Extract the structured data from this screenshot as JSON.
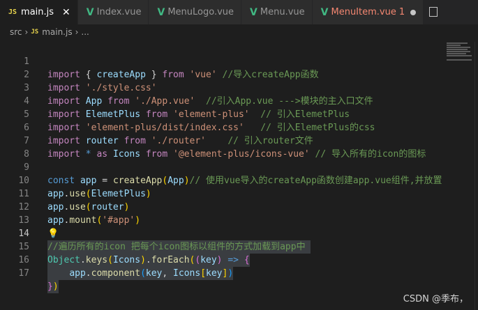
{
  "tabs": [
    {
      "label": "main.js",
      "icon": "js-icon",
      "active": true
    },
    {
      "label": "Index.vue",
      "icon": "vue-icon"
    },
    {
      "label": "MenuLogo.vue",
      "icon": "vue-icon"
    },
    {
      "label": "Menu.vue",
      "icon": "vue-icon"
    },
    {
      "label": "MenuItem.vue",
      "icon": "vue-icon",
      "badge": "1",
      "modified": true
    }
  ],
  "breadcrumb": {
    "folder": "src",
    "file": "main.js",
    "more": "..."
  },
  "icon_text": {
    "js": "JS",
    "vue": "V"
  },
  "line_numbers": [
    "1",
    "2",
    "3",
    "4",
    "5",
    "6",
    "7",
    "8",
    "9",
    "10",
    "11",
    "12",
    "13",
    "14",
    "15",
    "16",
    "17"
  ],
  "code": {
    "l1": [
      "import",
      " { ",
      "createApp",
      " } ",
      "from",
      " ",
      "'vue'",
      " ",
      "//导入createApp函数"
    ],
    "l2": [
      "import",
      " ",
      "'./style.css'"
    ],
    "l3": [
      "import",
      " ",
      "App",
      " ",
      "from",
      " ",
      "'./App.vue'",
      "  ",
      "//引入App.vue --->模块的主入口文件"
    ],
    "l4": [
      "import",
      " ",
      "ElemetPlus",
      " ",
      "from",
      " ",
      "'element-plus'",
      "  ",
      "// 引入ElemetPlus"
    ],
    "l5": [
      "import",
      " ",
      "'element-plus/dist/index.css'",
      "   ",
      "// 引入ElemetPlus的css"
    ],
    "l6": [
      "import",
      " ",
      "router",
      " ",
      "from",
      " ",
      "'./router'",
      "    ",
      "// 引入router文件"
    ],
    "l7": [
      "import",
      " ",
      "*",
      " ",
      "as",
      " ",
      "Icons",
      " ",
      "from",
      " ",
      "'@element-plus/icons-vue'",
      " ",
      "// 导入所有的icon的图标"
    ],
    "l9": [
      "const",
      " ",
      "app",
      " = ",
      "createApp",
      "(",
      "App",
      ")",
      "// 使用vue导入的createApp函数创建app.vue组件,并放置"
    ],
    "l10": [
      "app",
      ".",
      "use",
      "(",
      "ElemetPlus",
      ")"
    ],
    "l11": [
      "app",
      ".",
      "use",
      "(",
      "router",
      ")"
    ],
    "l12": [
      "app",
      ".",
      "mount",
      "(",
      "'#app'",
      ")"
    ],
    "l14": [
      "//遍历所有的icon 把每个icon图标以组件的方式加载到app中"
    ],
    "l15": [
      "Object",
      ".",
      "keys",
      "(",
      "Icons",
      ")",
      ".",
      "forEach",
      "(",
      "(",
      "key",
      ")",
      " => ",
      "{"
    ],
    "l16": [
      "    ",
      "app",
      ".",
      "component",
      "(",
      "key",
      ", ",
      "Icons",
      "[",
      "key",
      "]",
      ")"
    ],
    "l17": [
      "}",
      ")"
    ]
  },
  "watermark": "CSDN @季布，"
}
